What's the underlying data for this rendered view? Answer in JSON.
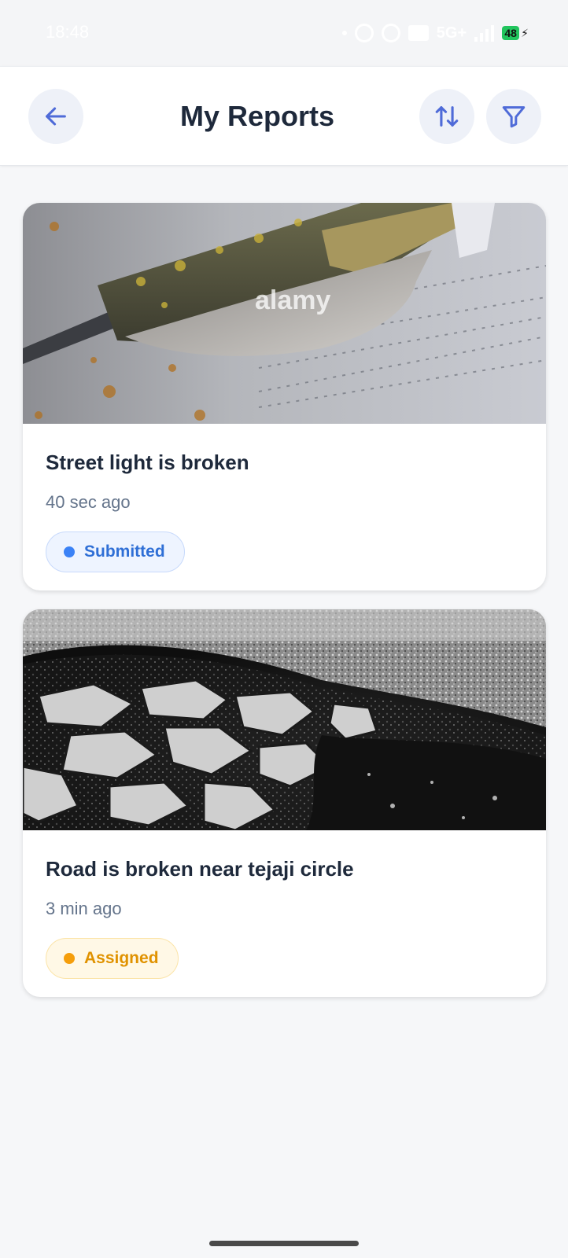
{
  "status_bar": {
    "time": "18:48",
    "network": "5G+",
    "battery": "48"
  },
  "header": {
    "title": "My Reports",
    "back_icon": "arrow-left-icon",
    "sort_icon": "sort-arrows-icon",
    "filter_icon": "funnel-icon"
  },
  "reports": [
    {
      "title": "Street light is broken",
      "time": "40 sec ago",
      "status": "Submitted",
      "status_color": "#3b82f6",
      "photo_watermark": "alamy"
    },
    {
      "title": "Road is broken near tejaji circle",
      "time": "3 min ago",
      "status": "Assigned",
      "status_color": "#f59e0b"
    }
  ],
  "colors": {
    "accent": "#4f6bd8",
    "background": "#f6f7f9"
  }
}
